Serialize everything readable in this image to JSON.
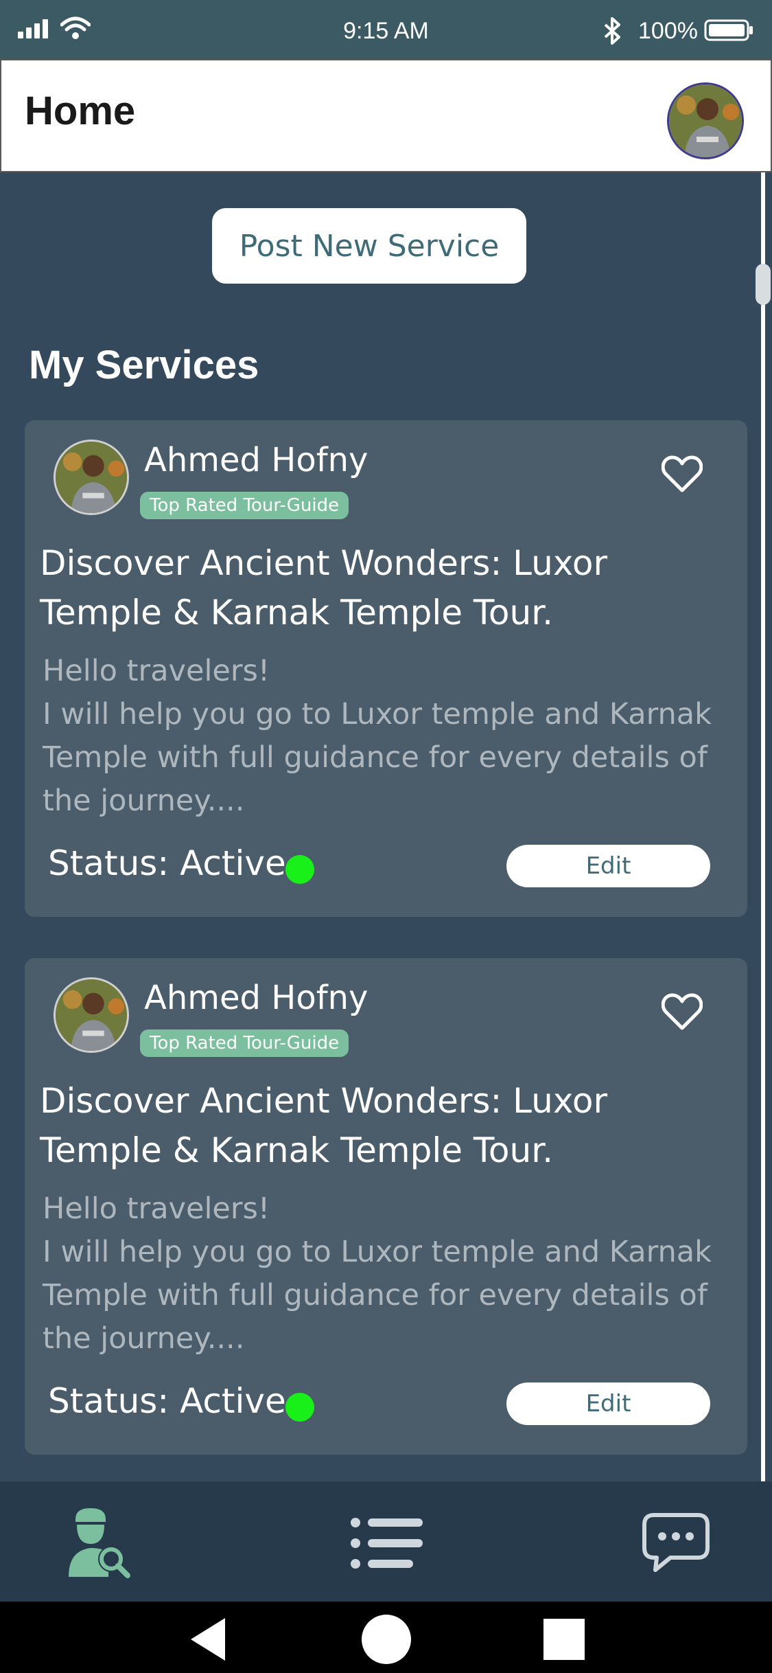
{
  "status_bar": {
    "time": "9:15 AM",
    "battery": "100%",
    "icons": [
      "signal-icon",
      "wifi-icon",
      "bluetooth-icon",
      "battery-icon"
    ]
  },
  "header": {
    "title": "Home",
    "avatar": "profile-avatar"
  },
  "post_button": "Post New Service",
  "section_title": "My Services",
  "services": [
    {
      "name": "Ahmed Hofny",
      "badge": "Top Rated Tour-Guide",
      "title": "Discover Ancient Wonders: Luxor Temple & Karnak Temple Tour.",
      "description": "Hello travelers!\nI will help you go to Luxor temple and Karnak Temple with full guidance for every details of the journey....",
      "status": "Status:  Active",
      "edit_label": "Edit"
    },
    {
      "name": "Ahmed Hofny",
      "badge": "Top Rated Tour-Guide",
      "title": "Discover Ancient Wonders: Luxor Temple & Karnak Temple Tour.",
      "description": "Hello travelers!\nI will help you go to Luxor temple and Karnak Temple with full guidance for every details of the journey....",
      "status": "Status:  Active",
      "edit_label": "Edit"
    }
  ],
  "colors": {
    "background": "#34495c",
    "card": "#4b5d6b",
    "status_bar": "#3b5a64",
    "accent": "#7cbf9f",
    "active_dot": "#19f019",
    "nav_bar": "#263a4b"
  },
  "bottom_nav": [
    "guide-search-icon",
    "list-icon",
    "chat-icon"
  ],
  "system_nav": [
    "back-icon",
    "home-icon",
    "recents-icon"
  ]
}
